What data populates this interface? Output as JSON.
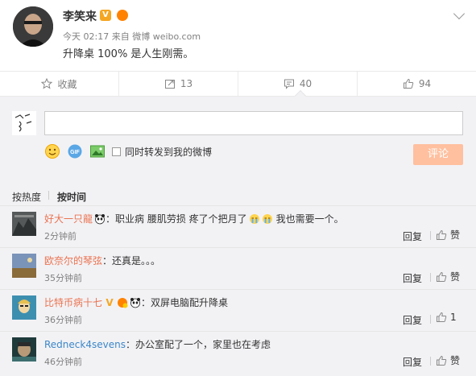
{
  "post": {
    "author": "李笑来",
    "time": "今天 02:17",
    "source_prefix": "来自",
    "source": "微博 weibo.com",
    "text": "升降桌 100% 是人生刚需。"
  },
  "actions": {
    "favorite": "收藏",
    "repost_count": "13",
    "comment_count": "40",
    "like_count": "94"
  },
  "compose": {
    "repost_label": "同时转发到我的微博",
    "submit_label": "评论"
  },
  "sort": {
    "hot": "按热度",
    "time": "按时间"
  },
  "comments": [
    {
      "user": "好大一只龍",
      "text": "：职业病 腰肌劳损 疼了个把月了",
      "text2": "我也需要一个。",
      "time": "2分钟前",
      "reply": "回复",
      "like": "赞"
    },
    {
      "user": "欧奈尔的琴弦",
      "text": "：还真是。。。",
      "time": "35分钟前",
      "reply": "回复",
      "like": "赞"
    },
    {
      "user": "比特币病十七",
      "text": "：双屏电脑配升降桌",
      "time": "36分钟前",
      "reply": "回复",
      "like": "1"
    },
    {
      "user": "Redneck4sevens",
      "text": "：办公室配了一个，家里也在考虑",
      "time": "46分钟前",
      "reply": "回复",
      "like": "赞"
    }
  ],
  "colors": {
    "username_orange": "#eb7350",
    "username_blue": "#3c87c8",
    "comment_button": "#ffc09f",
    "panel_bg": "#f2f2f5"
  },
  "icons": [
    "star-icon",
    "repost-icon",
    "comment-icon",
    "like-icon",
    "emoji-icon",
    "gif-icon",
    "image-icon",
    "panda-icon",
    "crying-icon",
    "verified-icon",
    "vip-icon"
  ]
}
